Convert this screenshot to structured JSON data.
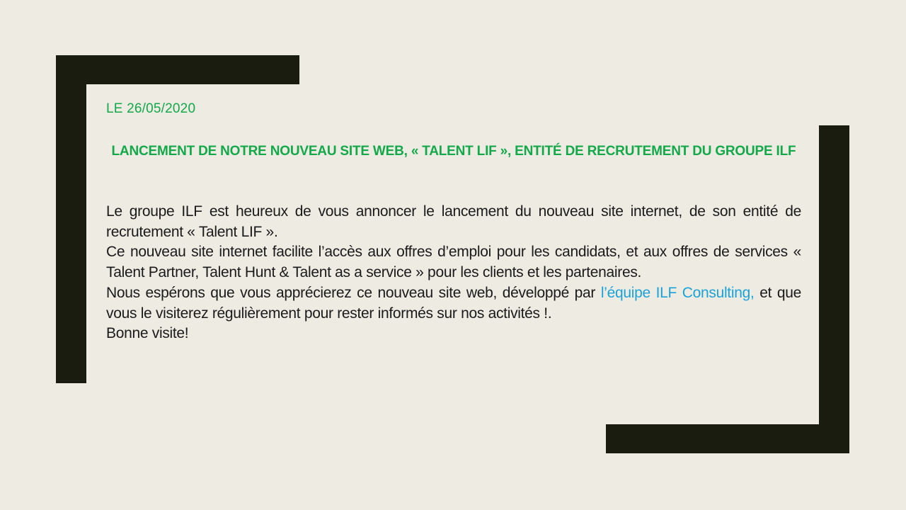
{
  "slide": {
    "date": "LE 26/05/2020",
    "headline": "LANCEMENT DE NOTRE NOUVEAU SITE WEB, « TALENT LIF », ENTITÉ DE RECRUTEMENT DU GROUPE ILF",
    "paragraphs": {
      "p1": "Le groupe ILF est heureux de vous annoncer le lancement du nouveau site internet, de son entité de recrutement « Talent LIF ».",
      "p2": "Ce nouveau site internet facilite l’accès aux offres d’emploi pour les candidats, et aux offres de services « Talent Partner, Talent Hunt & Talent as a service » pour les clients et les partenaires.",
      "p3_before_link": "Nous espérons que vous apprécierez ce nouveau site web, développé par ",
      "p3_link": "l’équipe ILF Consulting,",
      "p3_after_link": "  et que vous le visiterez régulièrement pour rester informés sur nos activités !.",
      "p4": "Bonne visite!"
    }
  },
  "colors": {
    "background": "#eeebe3",
    "bracket": "#1b1c10",
    "accent_green": "#13a84a",
    "link_blue": "#1ba3d8",
    "body_text": "#1a1a1a"
  }
}
